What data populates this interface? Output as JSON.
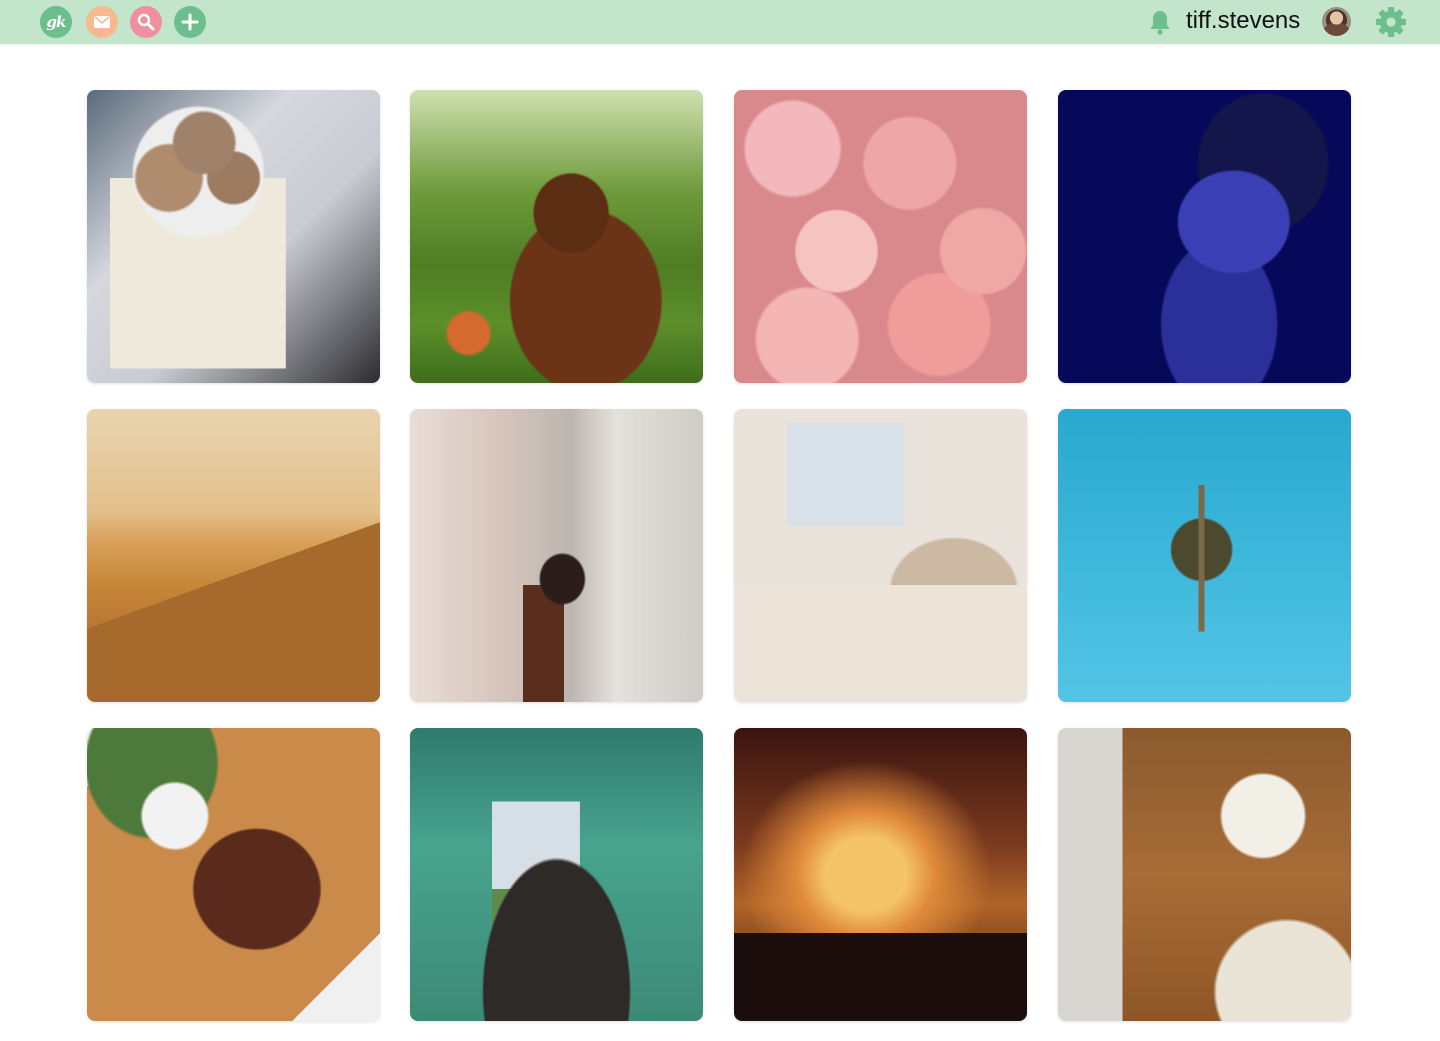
{
  "header": {
    "logo_text": "gk",
    "user": {
      "username": "tiff.stevens"
    },
    "icons": [
      "logo-icon",
      "mail-icon",
      "search-icon",
      "add-icon",
      "bell-icon",
      "avatar",
      "gear-icon"
    ],
    "colors": {
      "bar": "#c2e5cb",
      "green": "#6cbf8c",
      "mail": "#f8b98f",
      "search": "#ef8fa0"
    }
  },
  "gallery": {
    "photos": [
      {
        "label": "Cookies in a bowl on an open book with a daisy"
      },
      {
        "label": "Brown dog lying on grass with a ball"
      },
      {
        "label": "Pink ranunculus flowers"
      },
      {
        "label": "Woman with blue glitter body paint"
      },
      {
        "label": "Desert sand dunes at sunset"
      },
      {
        "label": "Woman leaning against a weathered wall"
      },
      {
        "label": "Bright living room with plants and guitar"
      },
      {
        "label": "Palm tree against a blue sky"
      },
      {
        "label": "Grilled steak on a wooden board"
      },
      {
        "label": "View from inside a tent toward the sea"
      },
      {
        "label": "Concert crowd with raised hands"
      },
      {
        "label": "Rustic dining table setting"
      }
    ]
  }
}
